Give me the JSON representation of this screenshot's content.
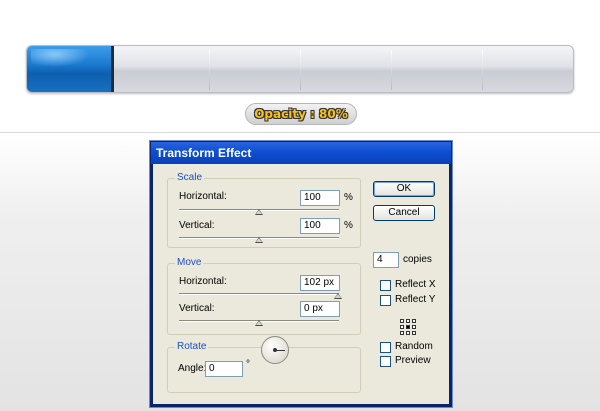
{
  "progress": {
    "fraction": 0.16,
    "segments": 5,
    "fill_color": "#1c7ad0"
  },
  "opacity_label": "Opacity : 80%",
  "dialog": {
    "title": "Transform Effect",
    "scale": {
      "group_title": "Scale",
      "horizontal_label": "Horizontal:",
      "horizontal_value": "100",
      "horizontal_unit": "%",
      "vertical_label": "Vertical:",
      "vertical_value": "100",
      "vertical_unit": "%"
    },
    "move": {
      "group_title": "Move",
      "horizontal_label": "Horizontal:",
      "horizontal_value": "102 px",
      "vertical_label": "Vertical:",
      "vertical_value": "0 px"
    },
    "rotate": {
      "group_title": "Rotate",
      "angle_label": "Angle:",
      "angle_value": "0",
      "angle_unit": "°"
    },
    "buttons": {
      "ok": "OK",
      "cancel": "Cancel"
    },
    "copies": {
      "value": "4",
      "label": "copies"
    },
    "checkboxes": {
      "reflect_x": "Reflect X",
      "reflect_y": "Reflect Y",
      "random": "Random",
      "preview": "Preview"
    },
    "accent_color": "#0e4fd1"
  }
}
